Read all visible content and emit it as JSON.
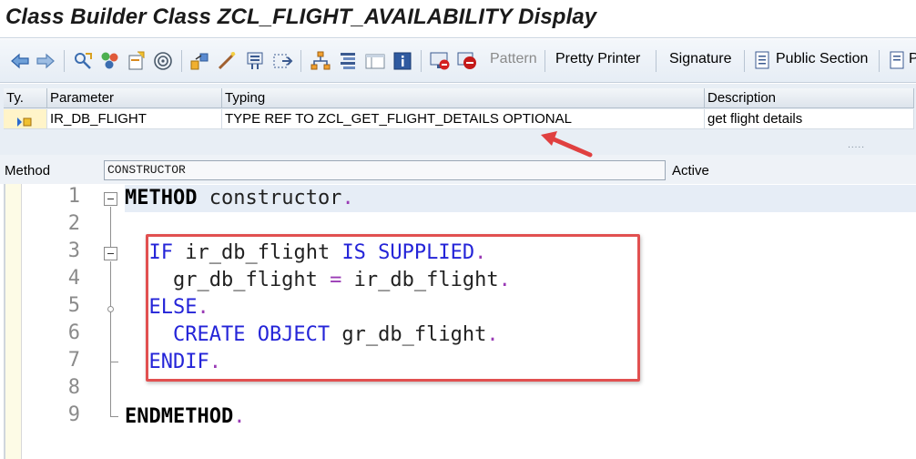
{
  "window": {
    "title": "Class Builder Class ZCL_FLIGHT_AVAILABILITY Display"
  },
  "toolbar": {
    "icons": [
      "back-arrow-icon",
      "forward-arrow-icon",
      "other-object-icon",
      "display-change-icon",
      "activate-icon",
      "where-used-icon",
      "navigate-icon",
      "object-list-icon",
      "enhancement-icon",
      "create-button-icon",
      "display-object-list-icon",
      "hierarchy-icon",
      "help-icon",
      "breakpoint-icon",
      "session-breakpoint-icon"
    ],
    "pattern_label": "Pattern",
    "pretty_printer_label": "Pretty Printer",
    "signature_label": "Signature",
    "public_section_label": "Public Section",
    "overflow_label": "P"
  },
  "params": {
    "headers": {
      "ty": "Ty.",
      "parameter": "Parameter",
      "typing": "Typing",
      "description": "Description"
    },
    "rows": [
      {
        "parameter": "IR_DB_FLIGHT",
        "typing": "TYPE REF TO ZCL_GET_FLIGHT_DETAILS OPTIONAL",
        "description": "get flight details"
      }
    ],
    "more_indicator": "....."
  },
  "method": {
    "label": "Method",
    "name": "CONSTRUCTOR",
    "status": "Active"
  },
  "editor": {
    "line_numbers": [
      "1",
      "2",
      "3",
      "4",
      "5",
      "6",
      "7",
      "8",
      "9"
    ],
    "lines": [
      {
        "tokens": [
          {
            "t": "METHOD",
            "c": "kw-b"
          },
          {
            "t": " ",
            "c": "id"
          },
          {
            "t": "constructor",
            "c": "id"
          },
          {
            "t": ".",
            "c": "pt"
          }
        ]
      },
      {
        "tokens": []
      },
      {
        "tokens": [
          {
            "t": "  ",
            "c": "id"
          },
          {
            "t": "IF",
            "c": "kw"
          },
          {
            "t": " ir_db_flight ",
            "c": "id"
          },
          {
            "t": "IS SUPPLIED",
            "c": "kw"
          },
          {
            "t": ".",
            "c": "pt"
          }
        ]
      },
      {
        "tokens": [
          {
            "t": "    gr_db_flight ",
            "c": "id"
          },
          {
            "t": "=",
            "c": "pt"
          },
          {
            "t": " ir_db_flight",
            "c": "id"
          },
          {
            "t": ".",
            "c": "pt"
          }
        ]
      },
      {
        "tokens": [
          {
            "t": "  ",
            "c": "id"
          },
          {
            "t": "ELSE",
            "c": "kw"
          },
          {
            "t": ".",
            "c": "pt"
          }
        ]
      },
      {
        "tokens": [
          {
            "t": "    ",
            "c": "id"
          },
          {
            "t": "CREATE OBJECT",
            "c": "kw"
          },
          {
            "t": " gr_db_flight",
            "c": "id"
          },
          {
            "t": ".",
            "c": "pt"
          }
        ]
      },
      {
        "tokens": [
          {
            "t": "  ",
            "c": "id"
          },
          {
            "t": "ENDIF",
            "c": "kw"
          },
          {
            "t": ".",
            "c": "pt"
          }
        ]
      },
      {
        "tokens": []
      },
      {
        "tokens": [
          {
            "t": "ENDMETHOD",
            "c": "kw-b"
          },
          {
            "t": ".",
            "c": "pt"
          }
        ]
      }
    ]
  },
  "colors": {
    "keyword": "#2424d8",
    "punctuation": "#9a3bb5",
    "annotation": "#e15050"
  }
}
